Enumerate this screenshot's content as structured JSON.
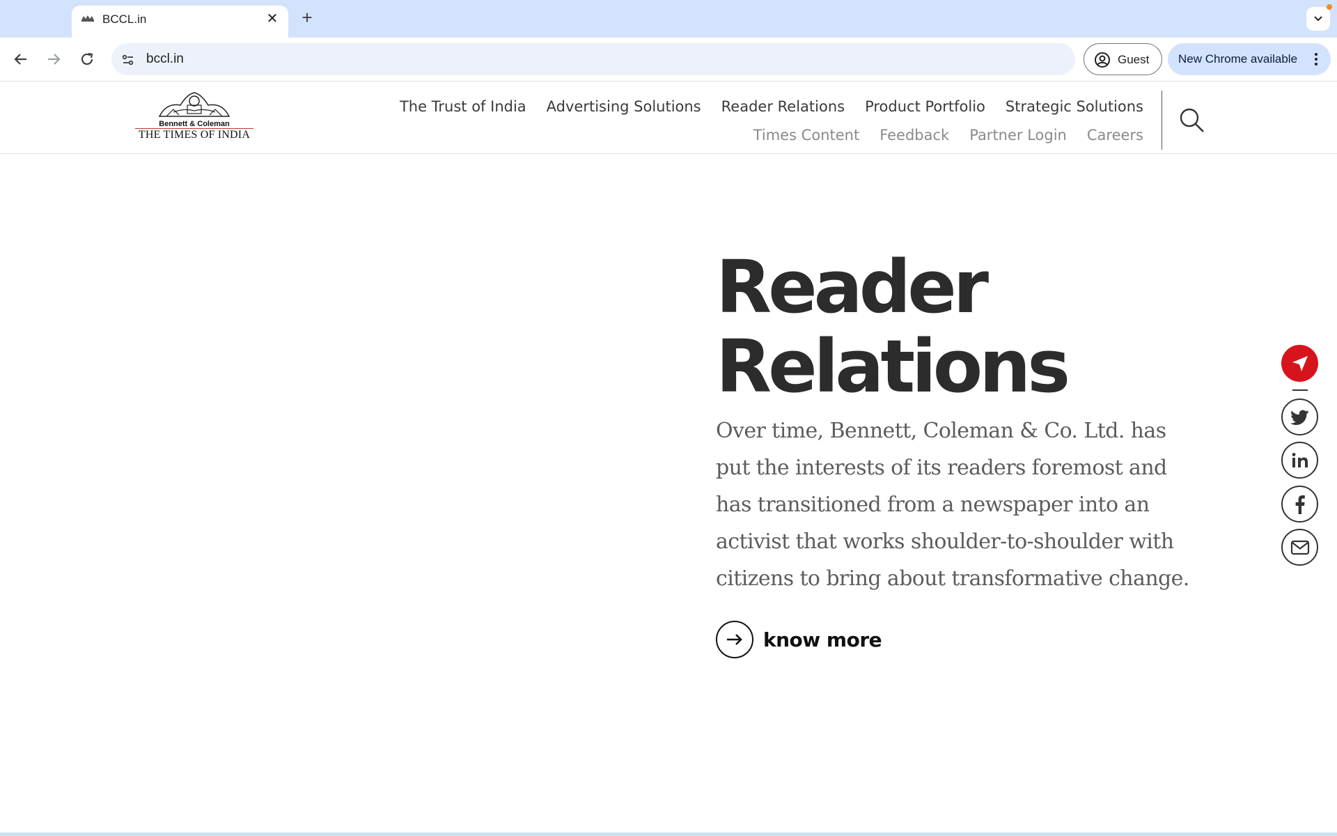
{
  "browser": {
    "tab_title": "BCCL.in",
    "url": "bccl.in",
    "profile_label": "Guest",
    "update_label": "New Chrome available"
  },
  "site": {
    "logo": {
      "line1": "Bennett & Coleman",
      "line2": "THE TIMES OF INDIA"
    },
    "nav_primary": [
      {
        "label": "The Trust of India"
      },
      {
        "label": "Advertising Solutions"
      },
      {
        "label": "Reader Relations"
      },
      {
        "label": "Product Portfolio"
      },
      {
        "label": "Strategic Solutions"
      }
    ],
    "nav_secondary": [
      {
        "label": "Times Content"
      },
      {
        "label": "Feedback"
      },
      {
        "label": "Partner Login"
      },
      {
        "label": "Careers"
      }
    ]
  },
  "hero": {
    "title_line1": "Reader",
    "title_line2": "Relations",
    "description": "Over time, Bennett, Coleman & Co. Ltd. has put the interests of its readers foremost and has transitioned from a newspaper into an activist that works shoulder-to-shoulder with citizens to bring about transformative change.",
    "cta_label": "know more"
  },
  "colors": {
    "accent_red": "#d6141c",
    "tab_strip": "#d3e3fd",
    "title_text": "#2c2c2c",
    "body_text": "#5c5c5c"
  },
  "icons": [
    "back-icon",
    "forward-icon",
    "reload-icon",
    "site-settings-icon",
    "profile-icon",
    "more-vert-icon",
    "search-icon",
    "arrow-right-icon",
    "share-icon",
    "twitter-icon",
    "linkedin-icon",
    "facebook-icon",
    "mail-icon"
  ]
}
